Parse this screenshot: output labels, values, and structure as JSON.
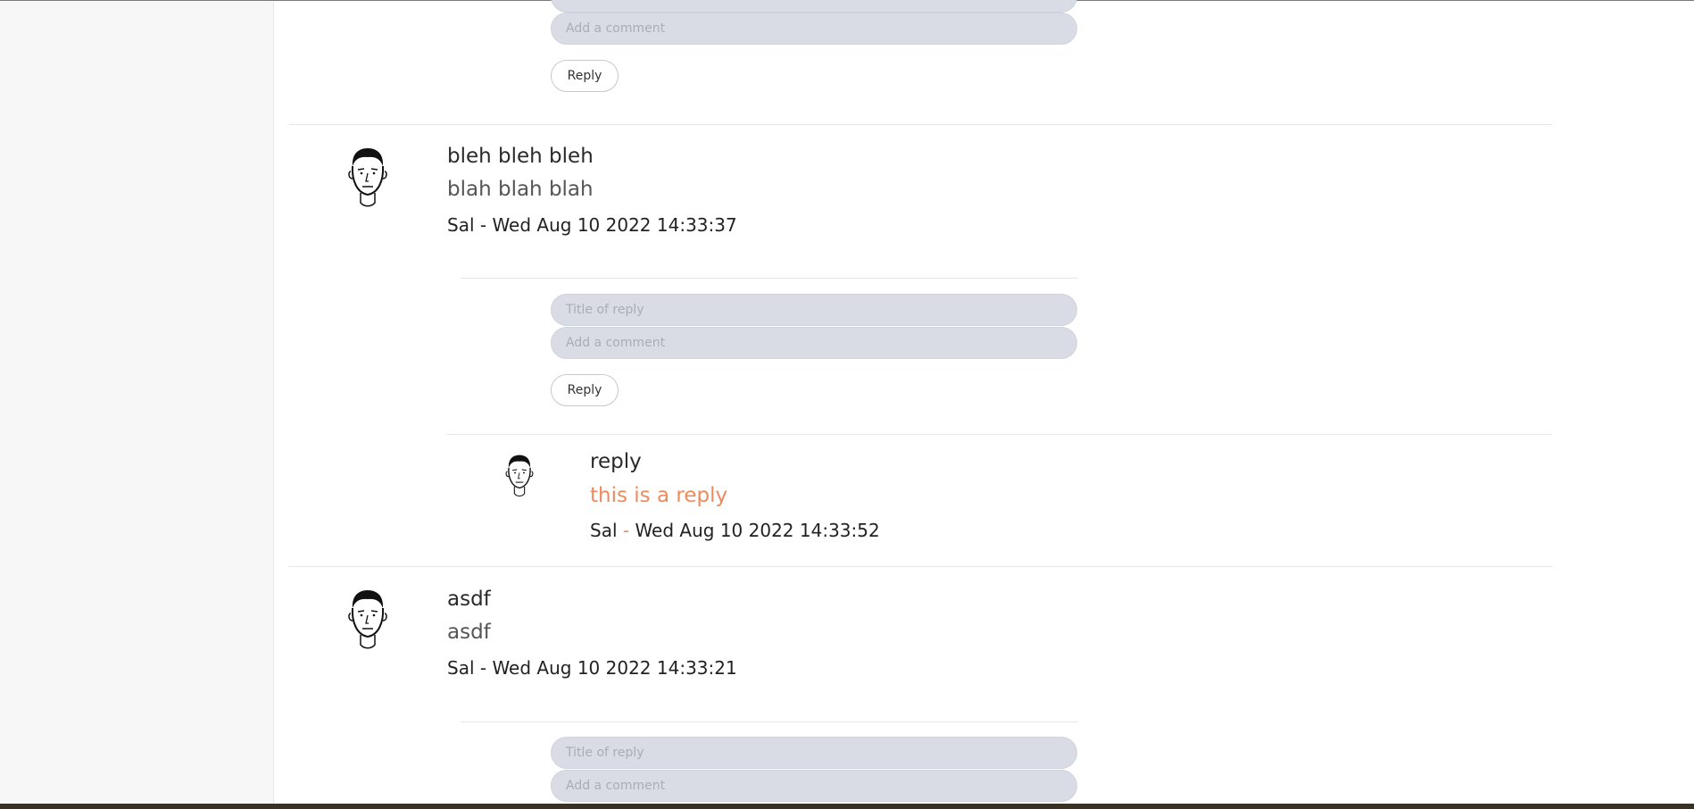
{
  "comments": [
    {
      "title": "bleh bleh bleh",
      "body": "blah blah blah",
      "author": "Sal",
      "separator": "-",
      "date": "Wed Aug 10 2022 14:33:37",
      "avatar": "face-avatar",
      "reply_form": {
        "title_placeholder": "Title of reply",
        "comment_placeholder": "Add a comment",
        "button_label": "Reply"
      },
      "replies": [
        {
          "title": "reply",
          "body": "this is a reply",
          "author": "Sal",
          "separator": "-",
          "date": "Wed Aug 10 2022 14:33:52",
          "avatar": "face-avatar",
          "accent_color": "#f08a5d"
        }
      ]
    },
    {
      "title": "asdf",
      "body": "asdf",
      "author": "Sal",
      "separator": "-",
      "date": "Wed Aug 10 2022 14:33:21",
      "avatar": "face-avatar",
      "reply_form": {
        "title_placeholder": "Title of reply",
        "comment_placeholder": "Add a comment"
      }
    }
  ],
  "previous_form": {
    "comment_placeholder": "Add a comment",
    "button_label": "Reply"
  },
  "colors": {
    "accent": "#f08a5d",
    "input_bg": "#d9dce4",
    "sidebar_bg": "#f7f7f7"
  }
}
